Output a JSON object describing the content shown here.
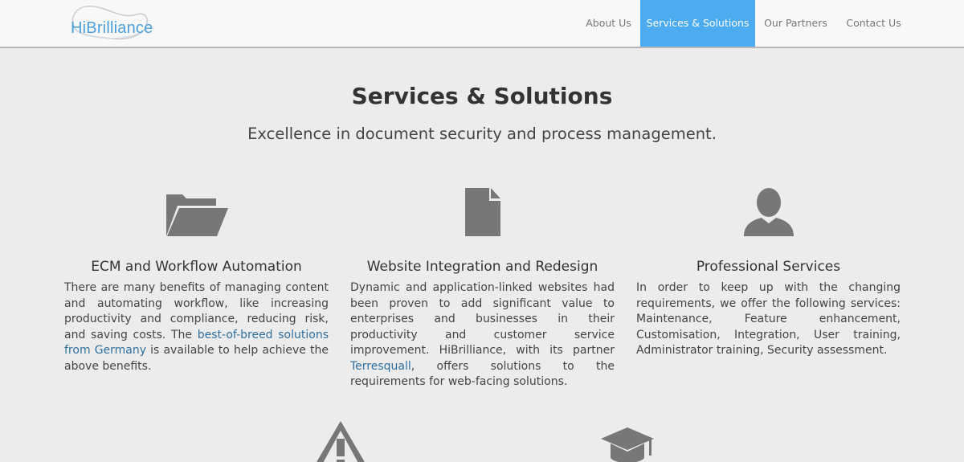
{
  "header": {
    "logo_text": "HiBrilliance",
    "nav": [
      {
        "label": "About Us",
        "active": false
      },
      {
        "label": "Services & Solutions",
        "active": true
      },
      {
        "label": "Our Partners",
        "active": false
      },
      {
        "label": "Contact Us",
        "active": false
      }
    ]
  },
  "main": {
    "title": "Services & Solutions",
    "subtitle": "Excellence in document security and process management.",
    "columns": [
      {
        "icon": "folder-open-icon",
        "title": "ECM and Workflow Automation",
        "text_before": "There are many benefits of managing content and automating workflow, like increasing productivity and compliance, reducing risk, and saving costs. The ",
        "link": "best-of-breed solutions from Germany",
        "text_after": " is available to help achieve the above benefits."
      },
      {
        "icon": "document-icon",
        "title": "Website Integration and Redesign",
        "text_before": "Dynamic and application-linked websites had been proven to add significant value to enterprises and businesses in their productivity and customer service improvement. HiBrilliance, with its partner ",
        "link": "Terresquall",
        "text_after": ", offers solutions to the requirements for web-facing solutions."
      },
      {
        "icon": "user-icon",
        "title": "Professional Services",
        "text_before": "In order to keep up with the changing requirements, we offer the following services: Maintenance, Feature enhancement, Customisation, Integration, User training, Administrator training, Security assessment.",
        "link": "",
        "text_after": ""
      }
    ],
    "bottom_icons": [
      "warning-icon",
      "graduation-cap-icon"
    ]
  },
  "colors": {
    "accent": "#4dacf0",
    "link": "#2f6f9f",
    "icon": "#777777",
    "background": "#ececec",
    "logo": "#4d9fd8"
  }
}
